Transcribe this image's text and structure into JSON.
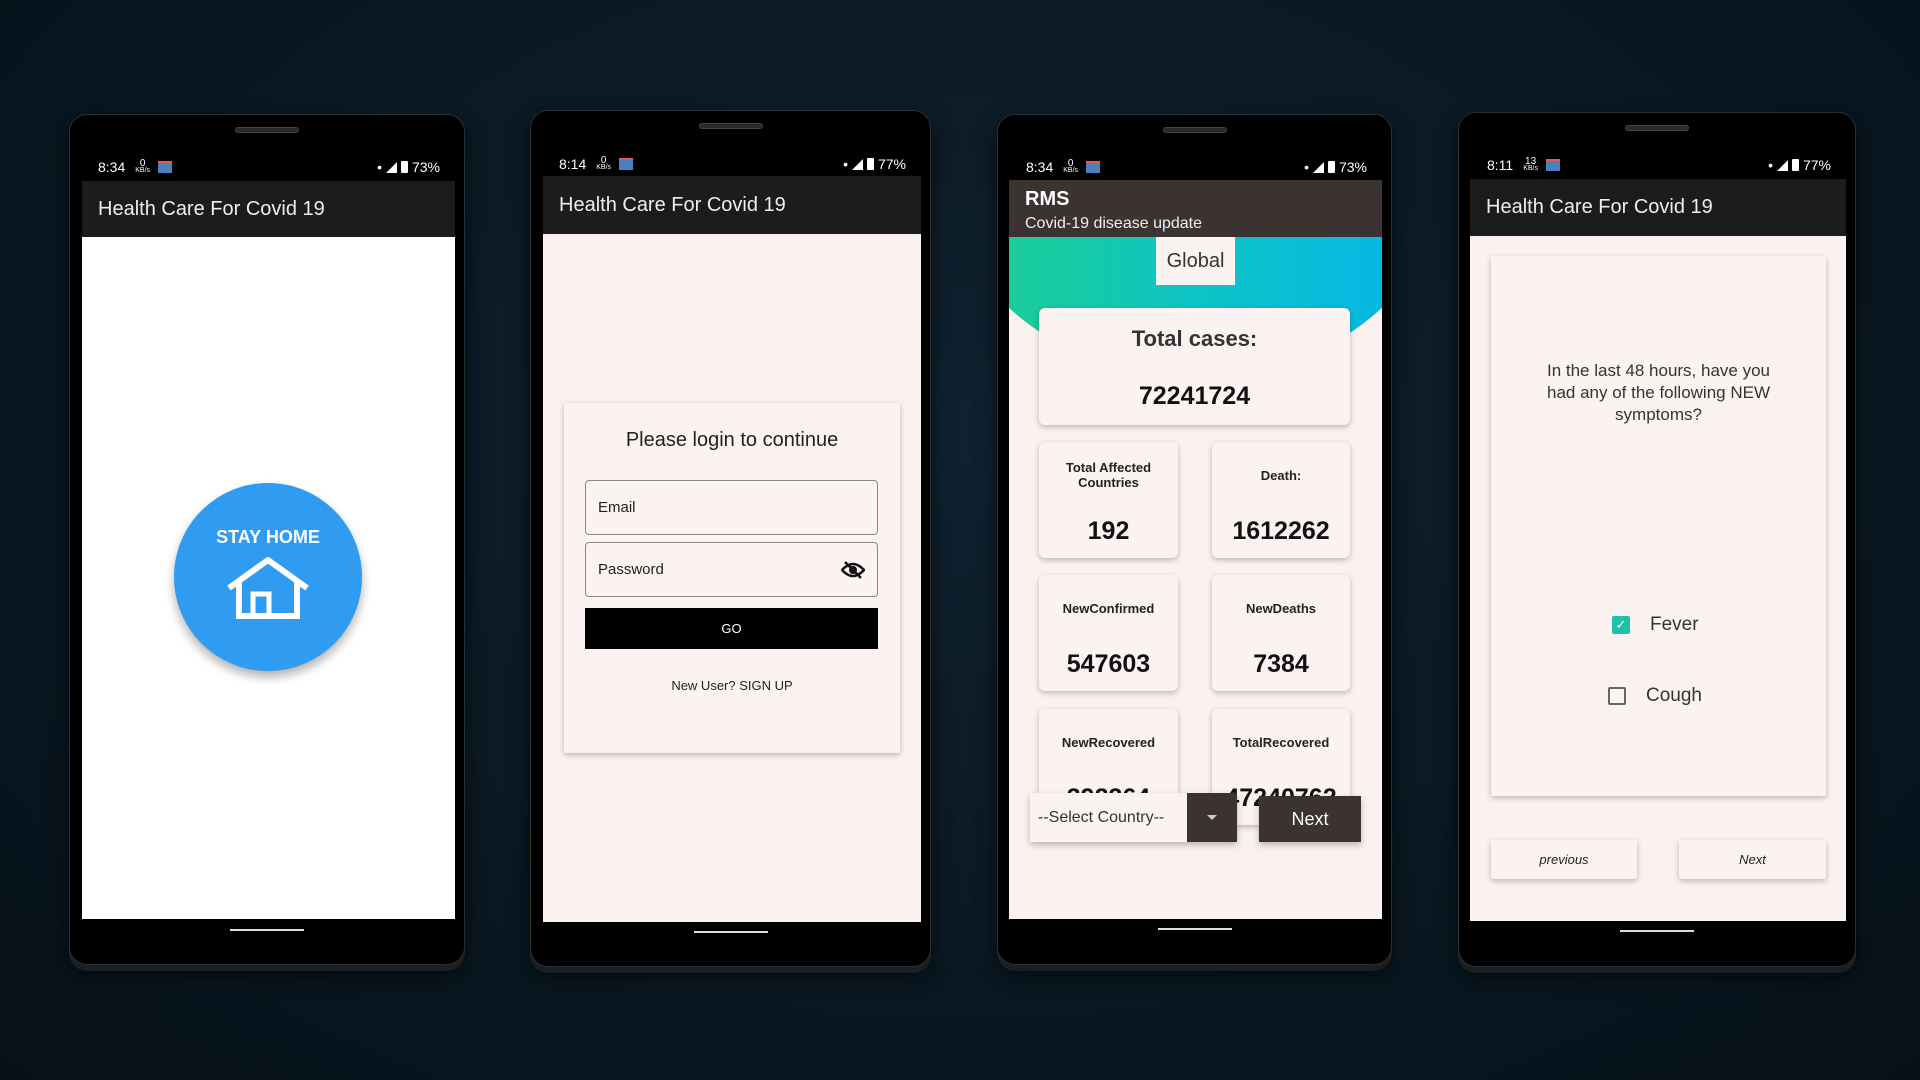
{
  "phones": [
    {
      "status": {
        "time": "8:34",
        "kb": "0",
        "kb_unit": "KB/s",
        "battery": "73%"
      },
      "app_title": "Health Care For Covid 19",
      "stay_home_label": "STAY HOME"
    },
    {
      "status": {
        "time": "8:14",
        "kb": "0",
        "kb_unit": "KB/s",
        "battery": "77%"
      },
      "app_title": "Health Care For Covid 19",
      "login": {
        "title": "Please login to continue",
        "email_placeholder": "Email",
        "password_placeholder": "Password",
        "go_label": "GO",
        "signup_label": "New User? SIGN UP"
      }
    },
    {
      "status": {
        "time": "8:34",
        "kb": "0",
        "kb_unit": "KB/s",
        "battery": "73%"
      },
      "app_title": "RMS",
      "app_subtitle": "Covid-19 disease update",
      "dashboard": {
        "scope": "Global",
        "total_label": "Total cases:",
        "total_value": "72241724",
        "stats": [
          {
            "label": "Total Affected Countries",
            "value": "192"
          },
          {
            "label": "Death:",
            "value": "1612262"
          },
          {
            "label": "NewConfirmed",
            "value": "547603"
          },
          {
            "label": "NewDeaths",
            "value": "7384"
          },
          {
            "label": "NewRecovered",
            "value": "392364"
          },
          {
            "label": "TotalRecovered",
            "value": "47240762"
          }
        ],
        "select_country": "--Select Country--",
        "next_label": "Next"
      }
    },
    {
      "status": {
        "time": "8:11",
        "kb": "13",
        "kb_unit": "KB/s",
        "battery": "77%"
      },
      "app_title": "Health Care For Covid 19",
      "survey": {
        "question": "In the last 48 hours, have you had any of the following NEW symptoms?",
        "options": [
          {
            "label": "Fever",
            "checked": true
          },
          {
            "label": "Cough",
            "checked": false
          }
        ],
        "previous_label": "previous",
        "next_label": "Next"
      }
    }
  ],
  "colors": {
    "accent_blue": "#2f9cf2",
    "check_teal": "#1fc1a8",
    "appbar": "#1c1c1c",
    "dark_button": "#3b3331"
  }
}
